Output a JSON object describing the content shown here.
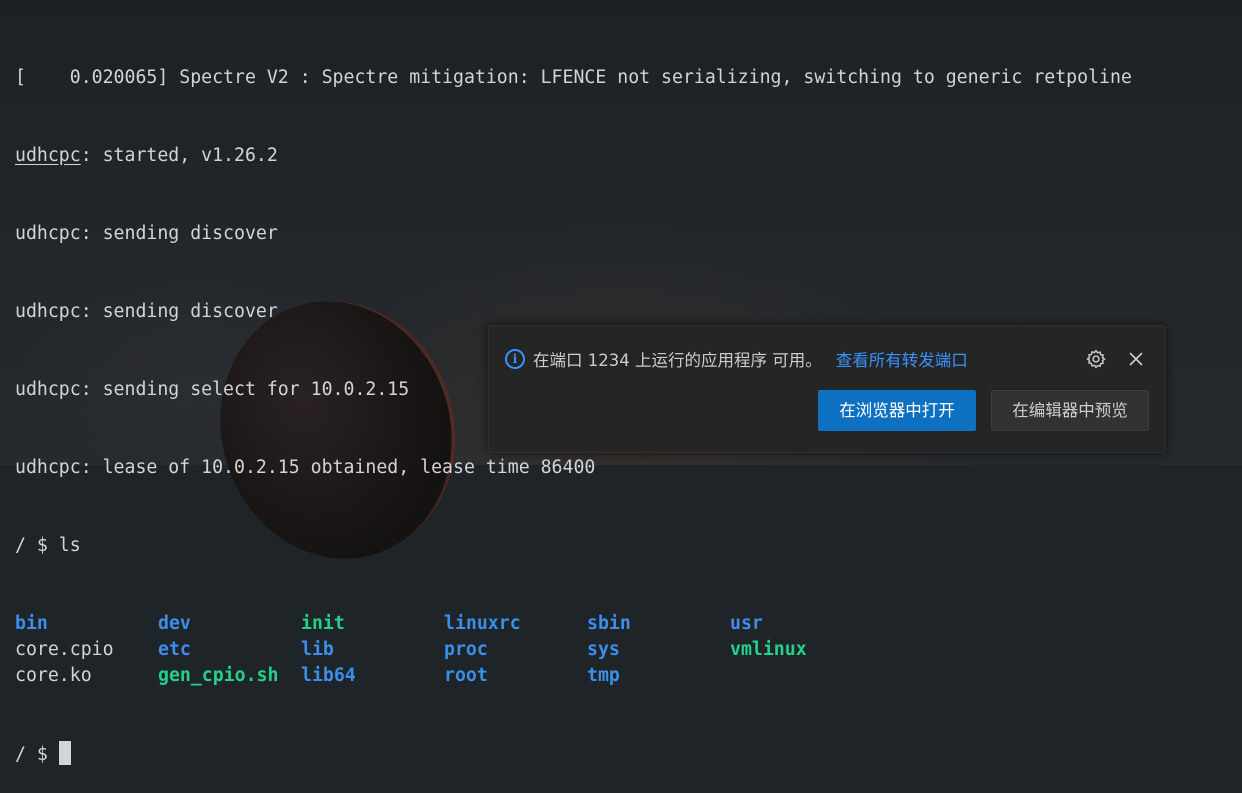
{
  "terminal": {
    "lines": [
      "[    0.020065] Spectre V2 : Spectre mitigation: LFENCE not serializing, switching to generic retpoline",
      ": started, v1.26.2",
      "udhcpc: sending discover",
      "udhcpc: sending discover",
      "udhcpc: sending select for 10.0.2.15",
      "udhcpc: lease of 10.0.2.15 obtained, lease time 86400",
      "/ $ ls"
    ],
    "underlined_word": "udhcpc",
    "ls_rows": [
      [
        {
          "name": "bin",
          "kind": "dir"
        },
        {
          "name": "dev",
          "kind": "dir"
        },
        {
          "name": "init",
          "kind": "exe"
        },
        {
          "name": "linuxrc",
          "kind": "dir"
        },
        {
          "name": "sbin",
          "kind": "dir"
        },
        {
          "name": "usr",
          "kind": "dir"
        }
      ],
      [
        {
          "name": "core.cpio",
          "kind": "file"
        },
        {
          "name": "etc",
          "kind": "dir"
        },
        {
          "name": "lib",
          "kind": "dir"
        },
        {
          "name": "proc",
          "kind": "dir"
        },
        {
          "name": "sys",
          "kind": "dir"
        },
        {
          "name": "vmlinux",
          "kind": "exe"
        }
      ],
      [
        {
          "name": "core.ko",
          "kind": "file"
        },
        {
          "name": "gen_cpio.sh",
          "kind": "exe"
        },
        {
          "name": "lib64",
          "kind": "dir"
        },
        {
          "name": "root",
          "kind": "dir"
        },
        {
          "name": "tmp",
          "kind": "dir"
        }
      ]
    ],
    "prompt": "/ $ "
  },
  "notification": {
    "icon": "info-icon",
    "message": "在端口 1234 上运行的应用程序 可用。",
    "link": "查看所有转发端口",
    "primary_button": "在浏览器中打开",
    "secondary_button": "在编辑器中预览",
    "settings_icon": "gear-icon",
    "close_icon": "close-icon"
  },
  "colors": {
    "terminal_text": "#d4d4d4",
    "directory": "#3b8eea",
    "executable": "#23d18b",
    "accent": "#3794ff",
    "button_primary": "#0e70c0"
  }
}
